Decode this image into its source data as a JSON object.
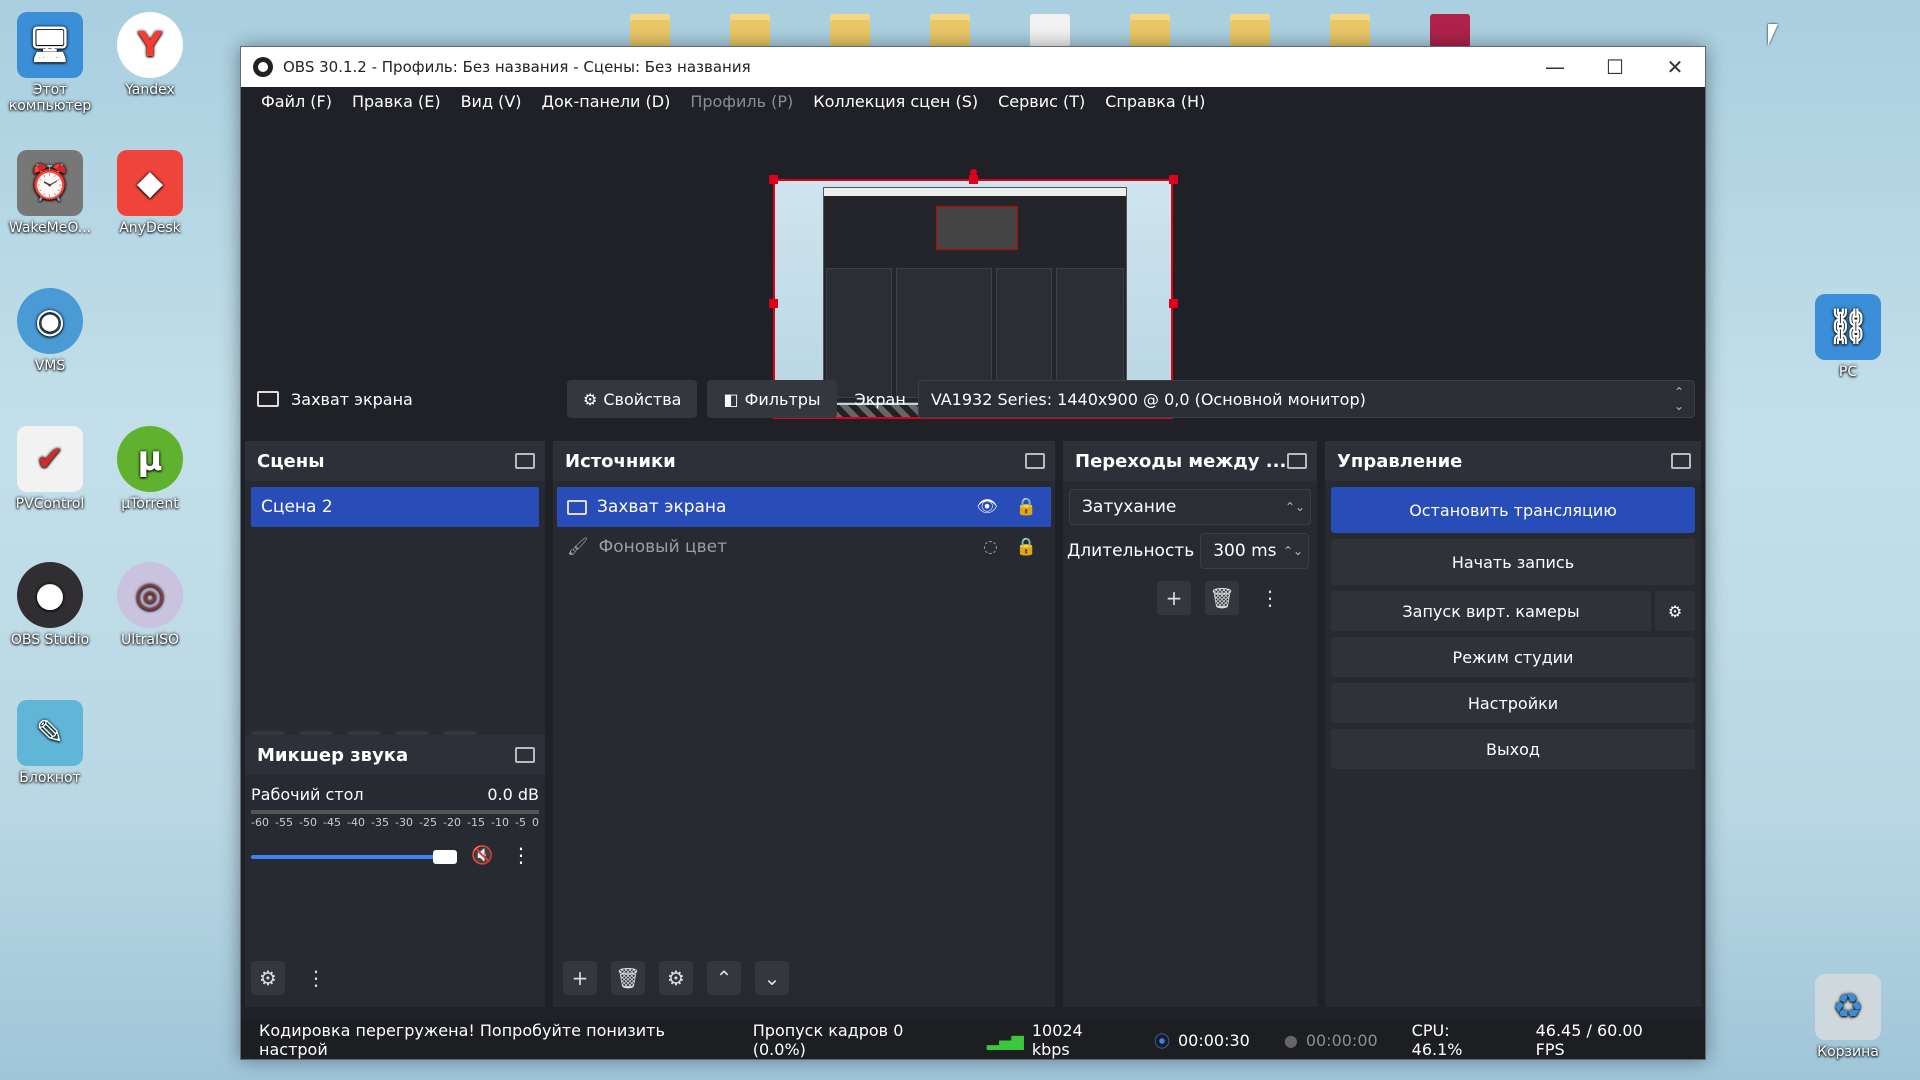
{
  "desktop": {
    "icons_left": [
      {
        "label": "Этот компьютер",
        "icon": "computer-icon",
        "color": "#3b8fd6"
      },
      {
        "label": "Yandex",
        "icon": "yandex-icon",
        "color": "#ff3a2d"
      },
      {
        "label": "WakeMeO...",
        "icon": "wakeme-icon",
        "color": "#777777"
      },
      {
        "label": "AnyDesk",
        "icon": "anydesk-icon",
        "color": "#ef443b"
      },
      {
        "label": "VMS",
        "icon": "vms-icon",
        "color": "#4a9ad6"
      },
      {
        "label": "PVControl",
        "icon": "pvcontrol-icon",
        "color": "#d22b2b"
      },
      {
        "label": "µTorrent",
        "icon": "utorrent-icon",
        "color": "#5fb12e"
      },
      {
        "label": "OBS Studio",
        "icon": "obs-icon",
        "color": "#302e31"
      },
      {
        "label": "UltraISO",
        "icon": "ultraiso-icon",
        "color": "#8a7bb4"
      },
      {
        "label": "Блокнот",
        "icon": "notepad-icon",
        "color": "#5fb6d6"
      }
    ],
    "icons_right": [
      {
        "label": "PC",
        "icon": "network-pc-icon",
        "color": "#3a8fd8"
      },
      {
        "label": "Корзина",
        "icon": "recycle-bin-icon",
        "color": "#cfd8dc"
      }
    ]
  },
  "window": {
    "title": "OBS 30.1.2 - Профиль: Без названия - Сцены: Без названия",
    "controls": {
      "minimize": "—",
      "maximize": "☐",
      "close": "✕"
    }
  },
  "menu": [
    {
      "label": "Файл (F)",
      "enabled": true
    },
    {
      "label": "Правка (E)",
      "enabled": true
    },
    {
      "label": "Вид (V)",
      "enabled": true
    },
    {
      "label": "Док-панели (D)",
      "enabled": true
    },
    {
      "label": "Профиль (P)",
      "enabled": false
    },
    {
      "label": "Коллекция сцен (S)",
      "enabled": true
    },
    {
      "label": "Сервис (T)",
      "enabled": true
    },
    {
      "label": "Справка (H)",
      "enabled": true
    }
  ],
  "source_toolbar": {
    "source_name": "Захват экрана",
    "properties": "Свойства",
    "filters": "Фильтры",
    "screen_label": "Экран",
    "screen_value": "VA1932 Series: 1440x900 @ 0,0 (Основной монитор)"
  },
  "scenes": {
    "title": "Сцены",
    "items": [
      "Сцена 2"
    ]
  },
  "sources": {
    "title": "Источники",
    "items": [
      {
        "name": "Захват экрана",
        "visible": true,
        "locked": false,
        "selected": true
      },
      {
        "name": "Фоновый цвет",
        "visible": false,
        "locked": false,
        "selected": false
      }
    ]
  },
  "transitions": {
    "title": "Переходы между ...",
    "selected": "Затухание",
    "duration_label": "Длительность",
    "duration_value": "300 ms"
  },
  "controls": {
    "title": "Управление",
    "stop_stream": "Остановить трансляцию",
    "start_record": "Начать запись",
    "virtual_cam": "Запуск вирт. камеры",
    "studio_mode": "Режим студии",
    "settings": "Настройки",
    "exit": "Выход"
  },
  "mixer": {
    "title": "Микшер звука",
    "channel": "Рабочий стол",
    "level": "0.0 dB",
    "scale": [
      "-60",
      "-55",
      "-50",
      "-45",
      "-40",
      "-35",
      "-30",
      "-25",
      "-20",
      "-15",
      "-10",
      "-5",
      "0"
    ],
    "volume": 0.96
  },
  "status": {
    "warning": "Кодировка перегружена! Попробуйте понизить настрой",
    "dropped": "Пропуск кадров 0 (0.0%)",
    "bitrate": "10024 kbps",
    "stream_time": "00:00:30",
    "record_time": "00:00:00",
    "cpu": "CPU: 46.1%",
    "fps": "46.45 / 60.00 FPS"
  },
  "colors": {
    "accent": "#284cb8",
    "selection_border": "#e0001b",
    "mute_red": "#d12b3c",
    "slider_blue": "#3b82f6"
  }
}
